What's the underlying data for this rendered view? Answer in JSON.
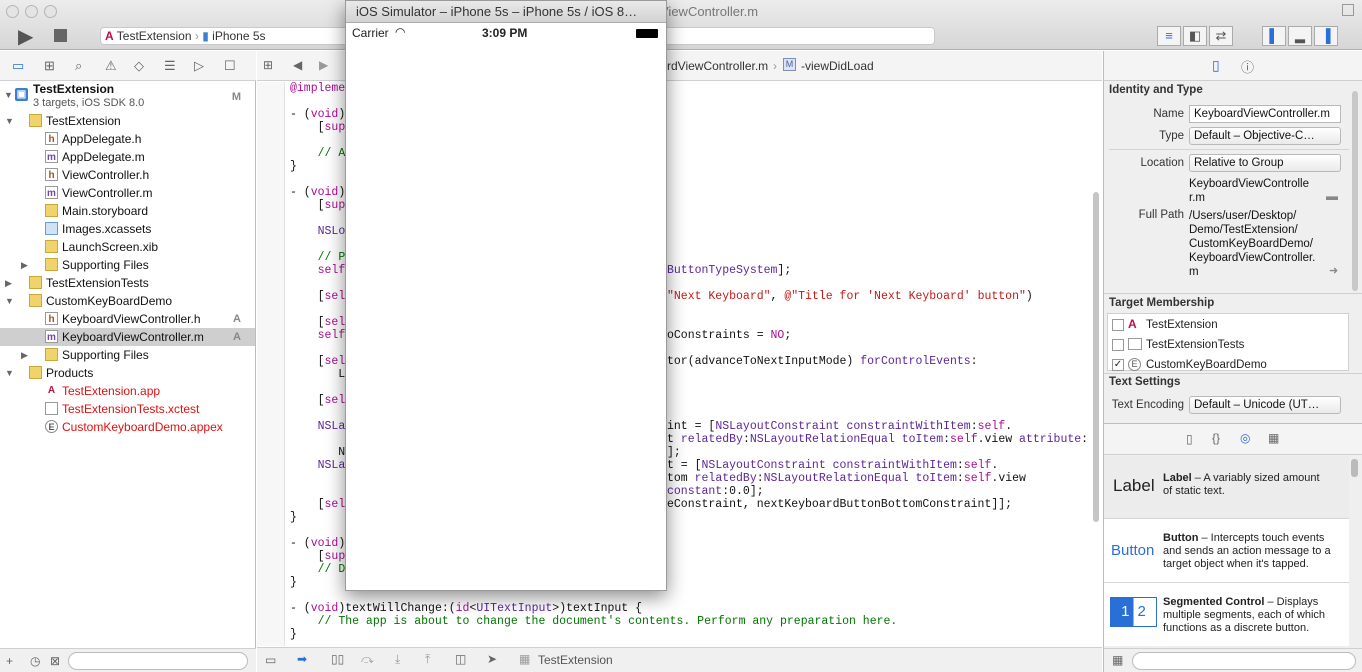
{
  "toolbar": {
    "scheme": "TestExtension",
    "device": "iPhone 5s",
    "window_title": "ViewController.m"
  },
  "navigator": {
    "project": {
      "name": "TestExtension",
      "subtitle": "3 targets, iOS SDK 8.0",
      "badge": "M"
    },
    "items": [
      {
        "label": "TestExtension",
        "kind": "folder",
        "indent": 1,
        "open": true
      },
      {
        "label": "AppDelegate.h",
        "kind": "h",
        "indent": 2
      },
      {
        "label": "AppDelegate.m",
        "kind": "m",
        "indent": 2
      },
      {
        "label": "ViewController.h",
        "kind": "h",
        "indent": 2
      },
      {
        "label": "ViewController.m",
        "kind": "m",
        "indent": 2
      },
      {
        "label": "Main.storyboard",
        "kind": "sb",
        "indent": 2
      },
      {
        "label": "Images.xcassets",
        "kind": "xa",
        "indent": 2
      },
      {
        "label": "LaunchScreen.xib",
        "kind": "xib",
        "indent": 2
      },
      {
        "label": "Supporting Files",
        "kind": "folder",
        "indent": 2,
        "open": false
      },
      {
        "label": "TestExtensionTests",
        "kind": "folder",
        "indent": 1,
        "open": false
      },
      {
        "label": "CustomKeyBoardDemo",
        "kind": "folder",
        "indent": 1,
        "open": true
      },
      {
        "label": "KeyboardViewController.h",
        "kind": "h",
        "indent": 2,
        "badge": "A"
      },
      {
        "label": "KeyboardViewController.m",
        "kind": "m",
        "indent": 2,
        "badge": "A",
        "selected": true
      },
      {
        "label": "Supporting Files",
        "kind": "folder",
        "indent": 2,
        "open": false
      },
      {
        "label": "Products",
        "kind": "folder",
        "indent": 1,
        "open": true
      },
      {
        "label": "TestExtension.app",
        "kind": "app",
        "indent": 2,
        "red": true
      },
      {
        "label": "TestExtensionTests.xctest",
        "kind": "xct",
        "indent": 2,
        "red": true
      },
      {
        "label": "CustomKeyboardDemo.appex",
        "kind": "appex",
        "indent": 2,
        "red": true
      }
    ]
  },
  "editor": {
    "jump_file": "rdViewController.m",
    "jump_symbol": "-viewDidLoad",
    "bottom_target": "TestExtension"
  },
  "simulator": {
    "title": "iOS Simulator – iPhone 5s – iPhone 5s / iOS 8…",
    "carrier": "Carrier",
    "time": "3:09 PM"
  },
  "inspector": {
    "identity_header": "Identity and Type",
    "name_label": "Name",
    "name_value": "KeyboardViewController.m",
    "type_label": "Type",
    "type_value": "Default – Objective-C…",
    "location_label": "Location",
    "location_value": "Relative to Group",
    "location_file_1": "KeyboardViewControlle",
    "location_file_2": "r.m",
    "fullpath_label": "Full Path",
    "fullpath_1": "/Users/user/Desktop/",
    "fullpath_2": "Demo/TestExtension/",
    "fullpath_3": "CustomKeyBoardDemo/",
    "fullpath_4": "KeyboardViewController.",
    "fullpath_5": "m",
    "target_header": "Target Membership",
    "targets": [
      {
        "label": "TestExtension",
        "checked": false
      },
      {
        "label": "TestExtensionTests",
        "checked": false
      },
      {
        "label": "CustomKeyBoardDemo",
        "checked": true
      }
    ],
    "text_header": "Text Settings",
    "encoding_label": "Text Encoding",
    "encoding_value": "Default – Unicode (UT…"
  },
  "library": {
    "items": [
      {
        "icon": "Label",
        "name": "Label",
        "desc_1": " – A variably sized amount",
        "desc_2": "of static text."
      },
      {
        "icon": "Button",
        "name": "Button",
        "desc_1": " – Intercepts touch events",
        "desc_2": "and sends an action message to a",
        "desc_3": "target object when it's tapped."
      },
      {
        "icon": "1 2",
        "name": "Segmented Control",
        "desc_1": " – Displays",
        "desc_2": "multiple segments, each of which",
        "desc_3": "functions as a discrete button."
      }
    ]
  },
  "colors": {
    "accent": "#2a6fd6",
    "selection": "#cfcfcf",
    "missing_file": "#dd1111"
  }
}
